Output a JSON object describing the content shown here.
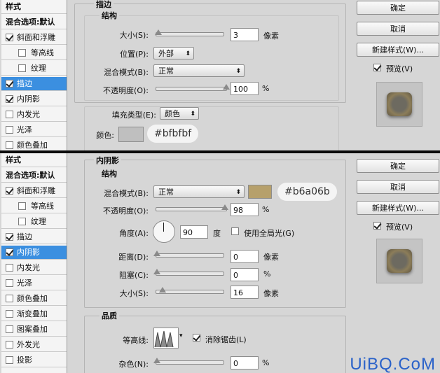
{
  "panel_top": {
    "styles_list": [
      {
        "label": "样式",
        "type": "header"
      },
      {
        "label": "混合选项:默认",
        "type": "header"
      },
      {
        "label": "斜面和浮雕",
        "checked": true
      },
      {
        "label": "等高线",
        "checked": false,
        "sub": true
      },
      {
        "label": "纹理",
        "checked": false,
        "sub": true
      },
      {
        "label": "描边",
        "checked": true,
        "selected": true
      },
      {
        "label": "内阴影",
        "checked": true
      },
      {
        "label": "内发光",
        "checked": false
      },
      {
        "label": "光泽",
        "checked": false
      },
      {
        "label": "颜色叠加",
        "checked": false
      }
    ],
    "section_title": "描边",
    "structure_title": "结构",
    "size_label": "大小(S):",
    "size_value": "3",
    "size_unit": "像素",
    "position_label": "位置(P):",
    "position_value": "外部",
    "blend_label": "混合模式(B):",
    "blend_value": "正常",
    "opacity_label": "不透明度(O):",
    "opacity_value": "100",
    "opacity_unit": "%",
    "fill_type_label": "填充类型(E):",
    "fill_type_value": "颜色",
    "color_label": "颜色:",
    "color_hex": "#bfbfbf",
    "color_swatch": "#bfbfbf",
    "levels": {
      "size": 0.03,
      "opacity": 1.0
    }
  },
  "panel_bottom": {
    "styles_list": [
      {
        "label": "样式",
        "type": "header"
      },
      {
        "label": "混合选项:默认",
        "type": "header"
      },
      {
        "label": "斜面和浮雕",
        "checked": true
      },
      {
        "label": "等高线",
        "checked": false,
        "sub": true
      },
      {
        "label": "纹理",
        "checked": false,
        "sub": true
      },
      {
        "label": "描边",
        "checked": true
      },
      {
        "label": "内阴影",
        "checked": true,
        "selected": true
      },
      {
        "label": "内发光",
        "checked": false
      },
      {
        "label": "光泽",
        "checked": false
      },
      {
        "label": "颜色叠加",
        "checked": false
      },
      {
        "label": "渐变叠加",
        "checked": false
      },
      {
        "label": "图案叠加",
        "checked": false
      },
      {
        "label": "外发光",
        "checked": false
      },
      {
        "label": "投影",
        "checked": false
      }
    ],
    "section_title": "内阴影",
    "structure_title": "结构",
    "blend_label": "混合模式(B):",
    "blend_value": "正常",
    "shadow_color": "#b6a06b",
    "shadow_hex": "#b6a06b",
    "opacity_label": "不透明度(O):",
    "opacity_value": "98",
    "opacity_unit": "%",
    "angle_label": "角度(A):",
    "angle_value": "90",
    "angle_unit": "度",
    "global_light_label": "使用全局光(G)",
    "global_light_checked": false,
    "distance_label": "距离(D):",
    "distance_value": "0",
    "distance_unit": "像素",
    "choke_label": "阻塞(C):",
    "choke_value": "0",
    "choke_unit": "%",
    "size_label": "大小(S):",
    "size_value": "16",
    "size_unit": "像素",
    "quality_title": "品质",
    "contour_label": "等高线:",
    "antialias_label": "消除锯齿(L)",
    "antialias_checked": true,
    "noise_label": "杂色(N):",
    "noise_value": "0",
    "noise_unit": "%",
    "levels": {
      "opacity": 0.98,
      "distance": 0.0,
      "choke": 0.0,
      "size": 0.064,
      "noise": 0.0
    }
  },
  "buttons": {
    "ok": "确定",
    "cancel": "取消",
    "new_style": "新建样式(W)..."
  },
  "preview_label": "预览(V)",
  "preview_checked": true,
  "watermark": "UiBQ.CoM"
}
